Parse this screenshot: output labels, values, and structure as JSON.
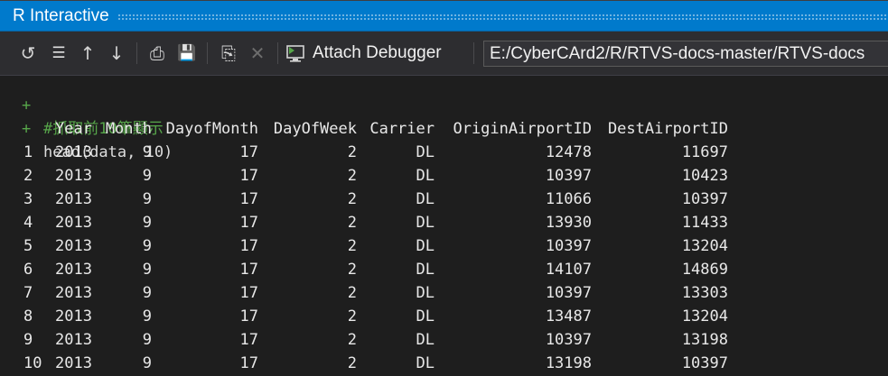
{
  "window": {
    "title": "R Interactive"
  },
  "toolbar": {
    "buttons": [
      {
        "name": "reset-button",
        "glyph": "↺"
      },
      {
        "name": "clear-button",
        "glyph": "☰"
      },
      {
        "name": "history-up-button",
        "glyph": "↑"
      },
      {
        "name": "history-down-button",
        "glyph": "↓"
      },
      {
        "name": "load-workspace-button",
        "glyph": "⎙"
      },
      {
        "name": "save-workspace-button",
        "glyph": "💾"
      },
      {
        "name": "source-file-button",
        "glyph": "⎘"
      },
      {
        "name": "interrupt-button",
        "glyph": "✕"
      }
    ],
    "attach_label": "Attach Debugger",
    "working_dir": "E:/CyberCArd2/R/RTVS-docs-master/RTVS-docs"
  },
  "console": {
    "prompt": "+",
    "comment": "#抓取前10筆顯示",
    "command": "head(data, 10)",
    "columns": [
      "Year",
      "Month",
      "DayofMonth",
      "DayOfWeek",
      "Carrier",
      "OriginAirportID",
      "DestAirportID"
    ],
    "rows": [
      {
        "n": "1",
        "Year": "2013",
        "Month": "9",
        "DayofMonth": "17",
        "DayOfWeek": "2",
        "Carrier": "DL",
        "Origin": "12478",
        "Dest": "11697"
      },
      {
        "n": "2",
        "Year": "2013",
        "Month": "9",
        "DayofMonth": "17",
        "DayOfWeek": "2",
        "Carrier": "DL",
        "Origin": "10397",
        "Dest": "10423"
      },
      {
        "n": "3",
        "Year": "2013",
        "Month": "9",
        "DayofMonth": "17",
        "DayOfWeek": "2",
        "Carrier": "DL",
        "Origin": "11066",
        "Dest": "10397"
      },
      {
        "n": "4",
        "Year": "2013",
        "Month": "9",
        "DayofMonth": "17",
        "DayOfWeek": "2",
        "Carrier": "DL",
        "Origin": "13930",
        "Dest": "11433"
      },
      {
        "n": "5",
        "Year": "2013",
        "Month": "9",
        "DayofMonth": "17",
        "DayOfWeek": "2",
        "Carrier": "DL",
        "Origin": "10397",
        "Dest": "13204"
      },
      {
        "n": "6",
        "Year": "2013",
        "Month": "9",
        "DayofMonth": "17",
        "DayOfWeek": "2",
        "Carrier": "DL",
        "Origin": "14107",
        "Dest": "14869"
      },
      {
        "n": "7",
        "Year": "2013",
        "Month": "9",
        "DayofMonth": "17",
        "DayOfWeek": "2",
        "Carrier": "DL",
        "Origin": "10397",
        "Dest": "13303"
      },
      {
        "n": "8",
        "Year": "2013",
        "Month": "9",
        "DayofMonth": "17",
        "DayOfWeek": "2",
        "Carrier": "DL",
        "Origin": "13487",
        "Dest": "13204"
      },
      {
        "n": "9",
        "Year": "2013",
        "Month": "9",
        "DayofMonth": "17",
        "DayOfWeek": "2",
        "Carrier": "DL",
        "Origin": "10397",
        "Dest": "13198"
      },
      {
        "n": "10",
        "Year": "2013",
        "Month": "9",
        "DayofMonth": "17",
        "DayOfWeek": "2",
        "Carrier": "DL",
        "Origin": "13198",
        "Dest": "10397"
      }
    ]
  },
  "colors": {
    "titlebar": "#007acc",
    "toolbar": "#2d2d30",
    "console_bg": "#1e1e1e",
    "prompt": "#57a64a",
    "text": "#dcdcdc"
  }
}
